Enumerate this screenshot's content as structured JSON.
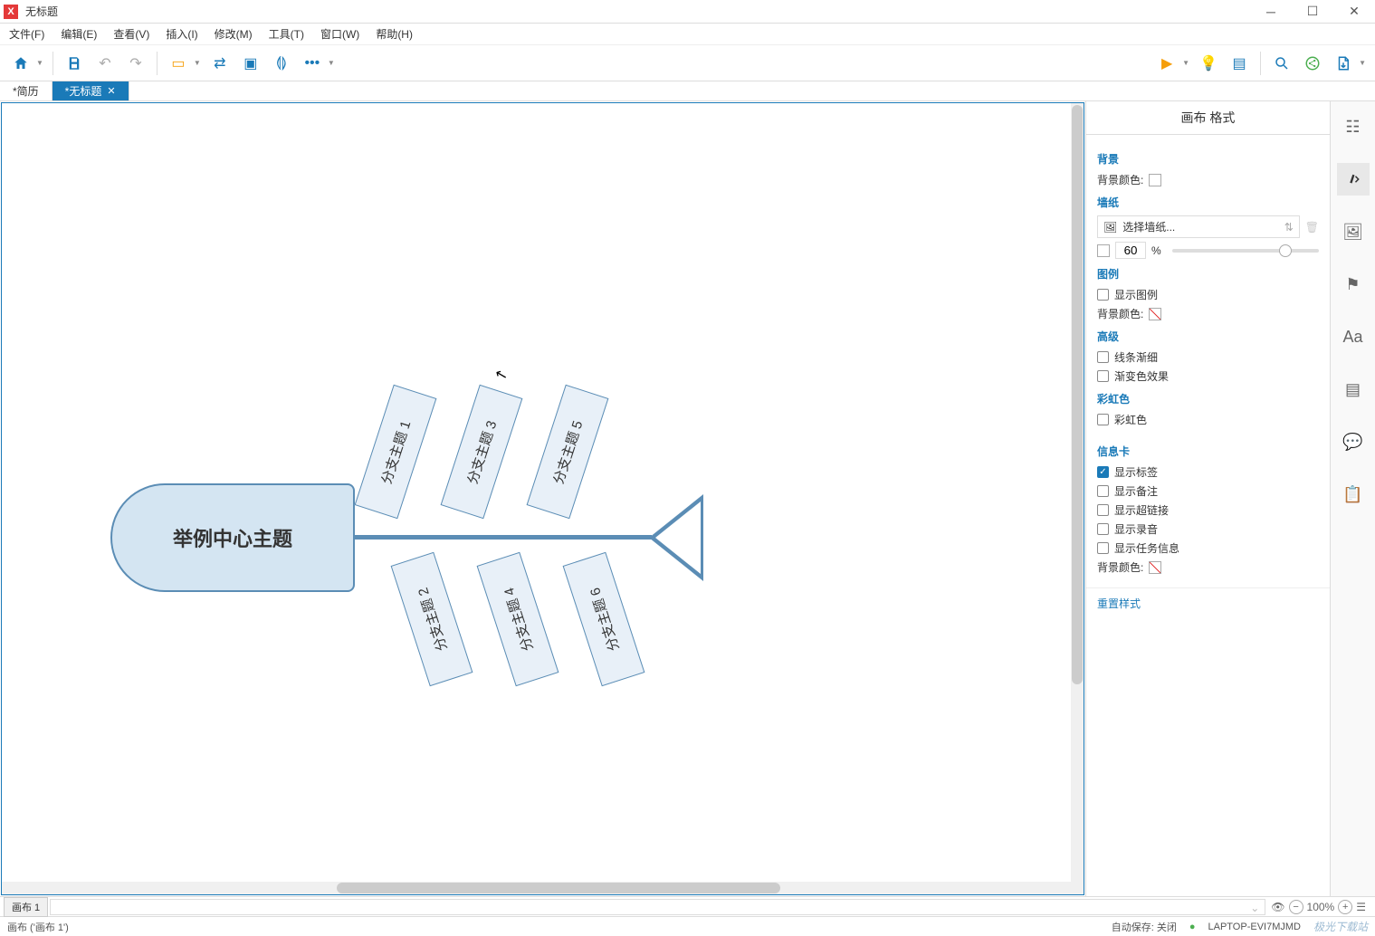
{
  "window": {
    "title": "无标题",
    "app_badge": "X"
  },
  "menus": {
    "file": "文件(F)",
    "edit": "编辑(E)",
    "view": "查看(V)",
    "insert": "插入(I)",
    "modify": "修改(M)",
    "tools": "工具(T)",
    "window": "窗口(W)",
    "help": "帮助(H)"
  },
  "tabs": {
    "history": "*简历",
    "untitled": "*无标题"
  },
  "diagram": {
    "center": "举例中心主题",
    "branches": [
      "分支主题 1",
      "分支主题 2",
      "分支主题 3",
      "分支主题 4",
      "分支主题 5",
      "分支主题 6"
    ]
  },
  "panel": {
    "title": "画布 格式",
    "background": "背景",
    "background_color": "背景颜色:",
    "wallpaper": "墙纸",
    "select_wallpaper": "选择墙纸...",
    "opacity_value": "60",
    "opacity_unit": "%",
    "legend": "图例",
    "show_legend": "显示图例",
    "advanced": "高级",
    "line_taper": "线条渐细",
    "gradient": "渐变色效果",
    "rainbow": "彩虹色",
    "rainbow_check": "彩虹色",
    "info_card": "信息卡",
    "show_label": "显示标签",
    "show_notes": "显示备注",
    "show_link": "显示超链接",
    "show_audio": "显示录音",
    "show_task": "显示任务信息",
    "reset": "重置样式"
  },
  "sheet": {
    "name": "画布 1",
    "zoom": "100%"
  },
  "status": {
    "left": "画布 ('画布 1')",
    "autosave": "自动保存: 关闭",
    "host": "LAPTOP-EVI7MJMD",
    "watermark": "极光下载站"
  }
}
